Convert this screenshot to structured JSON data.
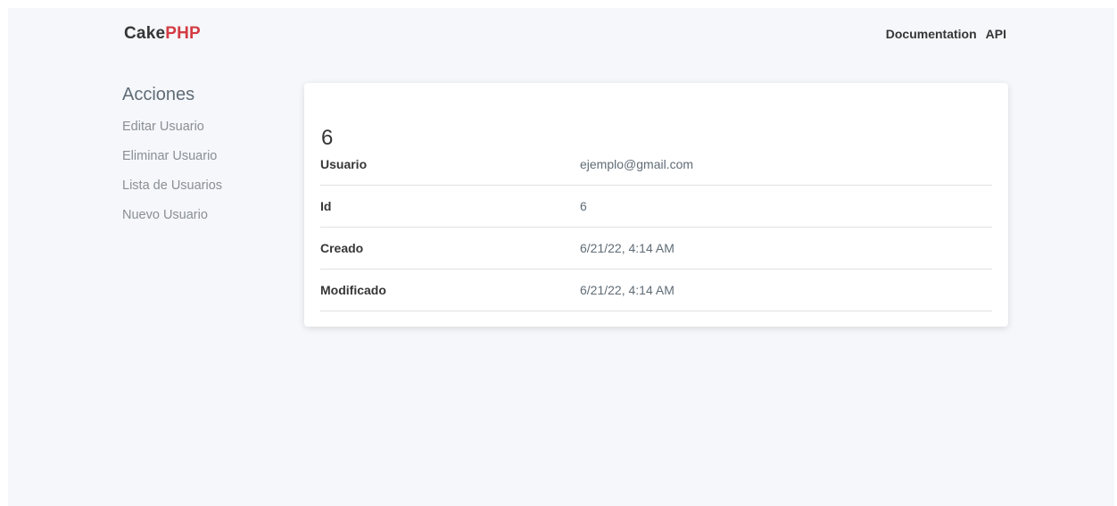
{
  "header": {
    "brand_part1": "Cake",
    "brand_part2": "PHP",
    "brand_accent": "#d33c43",
    "nav": [
      "Documentation",
      "API"
    ]
  },
  "sidebar": {
    "heading": "Acciones",
    "items": [
      "Editar Usuario",
      "Eliminar Usuario",
      "Lista de Usuarios",
      "Nuevo Usuario"
    ]
  },
  "detail": {
    "title": "6",
    "rows": [
      {
        "label": "Usuario",
        "value": "ejemplo@gmail.com"
      },
      {
        "label": "Id",
        "value": "6"
      },
      {
        "label": "Creado",
        "value": "6/21/22, 4:14 AM"
      },
      {
        "label": "Modificado",
        "value": "6/21/22, 4:14 AM"
      }
    ]
  }
}
